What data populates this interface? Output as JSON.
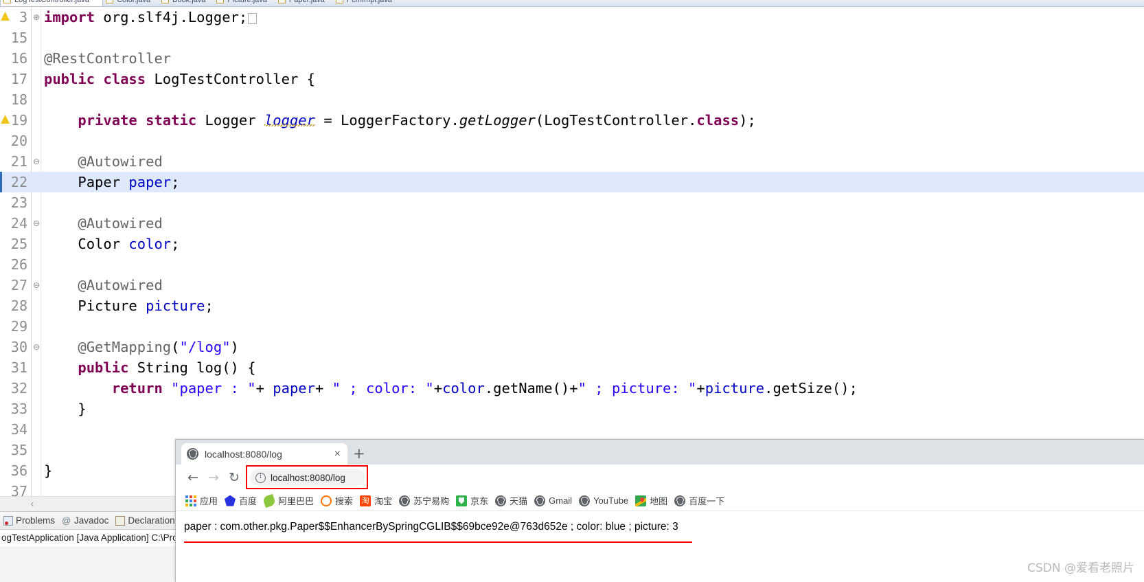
{
  "ide": {
    "editor_tabs": [
      {
        "label": "LogTestController.java",
        "active": true,
        "dirty": true
      },
      {
        "label": "Color.java",
        "active": false,
        "warn": false
      },
      {
        "label": "Book.java",
        "active": false,
        "warn": true
      },
      {
        "label": "Picture.java",
        "active": false,
        "warn": false
      },
      {
        "label": "Paper.java",
        "active": false,
        "warn": false
      },
      {
        "label": "PcmImpl.java",
        "active": false,
        "warn": false
      }
    ],
    "code_lines": [
      {
        "no": "3",
        "fold": "⊕",
        "warn": true,
        "indent": 0,
        "tokens": [
          {
            "t": "import",
            "c": "kw"
          },
          {
            "t": " org.slf4j.Logger;",
            "c": "plain"
          },
          {
            "t": "□",
            "c": "boxmark"
          }
        ]
      },
      {
        "no": "15",
        "fold": "",
        "warn": false,
        "tokens": []
      },
      {
        "no": "16",
        "fold": "",
        "warn": false,
        "tokens": [
          {
            "t": "@RestController",
            "c": "ann"
          }
        ]
      },
      {
        "no": "17",
        "fold": "",
        "warn": false,
        "tokens": [
          {
            "t": "public",
            "c": "kw"
          },
          {
            "t": " ",
            "c": "plain"
          },
          {
            "t": "class",
            "c": "kw"
          },
          {
            "t": " LogTestController {",
            "c": "plain"
          }
        ]
      },
      {
        "no": "18",
        "fold": "",
        "warn": false,
        "tokens": []
      },
      {
        "no": "19",
        "fold": "",
        "warn": true,
        "tokens": [
          {
            "t": "    ",
            "c": "plain"
          },
          {
            "t": "private",
            "c": "kw"
          },
          {
            "t": " ",
            "c": "plain"
          },
          {
            "t": "static",
            "c": "kw"
          },
          {
            "t": " Logger ",
            "c": "plain"
          },
          {
            "t": "logger",
            "c": "fldi-squig"
          },
          {
            "t": " = LoggerFactory.",
            "c": "plain"
          },
          {
            "t": "getLogger",
            "c": "mth"
          },
          {
            "t": "(LogTestController.",
            "c": "plain"
          },
          {
            "t": "class",
            "c": "kw"
          },
          {
            "t": ");",
            "c": "plain"
          }
        ]
      },
      {
        "no": "20",
        "fold": "",
        "warn": false,
        "tokens": []
      },
      {
        "no": "21",
        "fold": "⊖",
        "warn": false,
        "tokens": [
          {
            "t": "    ",
            "c": "plain"
          },
          {
            "t": "@Autowired",
            "c": "ann"
          }
        ]
      },
      {
        "no": "22",
        "fold": "",
        "warn": false,
        "highlight": true,
        "tokens": [
          {
            "t": "    Paper ",
            "c": "plain"
          },
          {
            "t": "paper",
            "c": "fld"
          },
          {
            "t": ";",
            "c": "plain"
          }
        ]
      },
      {
        "no": "23",
        "fold": "",
        "warn": false,
        "tokens": []
      },
      {
        "no": "24",
        "fold": "⊖",
        "warn": false,
        "tokens": [
          {
            "t": "    ",
            "c": "plain"
          },
          {
            "t": "@Autowired",
            "c": "ann"
          }
        ]
      },
      {
        "no": "25",
        "fold": "",
        "warn": false,
        "tokens": [
          {
            "t": "    Color ",
            "c": "plain"
          },
          {
            "t": "color",
            "c": "fld"
          },
          {
            "t": ";",
            "c": "plain"
          }
        ]
      },
      {
        "no": "26",
        "fold": "",
        "warn": false,
        "tokens": []
      },
      {
        "no": "27",
        "fold": "⊖",
        "warn": false,
        "tokens": [
          {
            "t": "    ",
            "c": "plain"
          },
          {
            "t": "@Autowired",
            "c": "ann"
          }
        ]
      },
      {
        "no": "28",
        "fold": "",
        "warn": false,
        "tokens": [
          {
            "t": "    Picture ",
            "c": "plain"
          },
          {
            "t": "picture",
            "c": "fld"
          },
          {
            "t": ";",
            "c": "plain"
          }
        ]
      },
      {
        "no": "29",
        "fold": "",
        "warn": false,
        "tokens": []
      },
      {
        "no": "30",
        "fold": "⊖",
        "warn": false,
        "tokens": [
          {
            "t": "    ",
            "c": "plain"
          },
          {
            "t": "@GetMapping",
            "c": "ann"
          },
          {
            "t": "(",
            "c": "plain"
          },
          {
            "t": "\"/log\"",
            "c": "str"
          },
          {
            "t": ")",
            "c": "plain"
          }
        ]
      },
      {
        "no": "31",
        "fold": "",
        "warn": false,
        "tokens": [
          {
            "t": "    ",
            "c": "plain"
          },
          {
            "t": "public",
            "c": "kw"
          },
          {
            "t": " String log() {",
            "c": "plain"
          }
        ]
      },
      {
        "no": "32",
        "fold": "",
        "warn": false,
        "tokens": [
          {
            "t": "        ",
            "c": "plain"
          },
          {
            "t": "return",
            "c": "kw"
          },
          {
            "t": " ",
            "c": "plain"
          },
          {
            "t": "\"paper : \"",
            "c": "str"
          },
          {
            "t": "+ ",
            "c": "plain"
          },
          {
            "t": "paper",
            "c": "fld"
          },
          {
            "t": "+ ",
            "c": "plain"
          },
          {
            "t": "\" ; color: \"",
            "c": "str"
          },
          {
            "t": "+",
            "c": "plain"
          },
          {
            "t": "color",
            "c": "fld"
          },
          {
            "t": ".getName()+",
            "c": "plain"
          },
          {
            "t": "\" ; picture: \"",
            "c": "str"
          },
          {
            "t": "+",
            "c": "plain"
          },
          {
            "t": "picture",
            "c": "fld"
          },
          {
            "t": ".getSize();",
            "c": "plain"
          }
        ]
      },
      {
        "no": "33",
        "fold": "",
        "warn": false,
        "tokens": [
          {
            "t": "    }",
            "c": "plain"
          }
        ]
      },
      {
        "no": "34",
        "fold": "",
        "warn": false,
        "tokens": []
      },
      {
        "no": "35",
        "fold": "",
        "warn": false,
        "tokens": []
      },
      {
        "no": "36",
        "fold": "",
        "warn": false,
        "tokens": [
          {
            "t": "}",
            "c": "plain"
          }
        ]
      },
      {
        "no": "37",
        "fold": "",
        "warn": false,
        "tokens": []
      }
    ],
    "hscroll_arrow": "‹",
    "view_tabs": [
      {
        "label": "Problems",
        "icon": "problems-icon"
      },
      {
        "label": "Javadoc",
        "icon": "at-icon"
      },
      {
        "label": "Declaration",
        "icon": "declaration-icon"
      },
      {
        "label": "",
        "icon": "pencil-icon"
      }
    ],
    "console_line": "ogTestApplication [Java Application] C:\\Progra"
  },
  "browser": {
    "tab": {
      "title": "localhost:8080/log",
      "favicon": "globe-icon",
      "close_label": "×"
    },
    "new_tab_label": "+",
    "nav": {
      "back": "←",
      "forward": "→",
      "reload": "↻"
    },
    "omnibox": {
      "url": "localhost:8080/log",
      "info_icon": "info-circle-icon",
      "highlight_color": "#ff0000"
    },
    "bookmarks": [
      {
        "label": "应用",
        "icon": "apps-grid-icon"
      },
      {
        "label": "百度",
        "icon": "baidu-icon"
      },
      {
        "label": "阿里巴巴",
        "icon": "alibaba-icon"
      },
      {
        "label": "搜索",
        "icon": "sogou-icon"
      },
      {
        "label": "淘宝",
        "icon": "taobao-icon"
      },
      {
        "label": "苏宁易购",
        "icon": "globe-icon"
      },
      {
        "label": "京东",
        "icon": "jd-icon"
      },
      {
        "label": "天猫",
        "icon": "globe-icon"
      },
      {
        "label": "Gmail",
        "icon": "globe-icon"
      },
      {
        "label": "YouTube",
        "icon": "globe-icon"
      },
      {
        "label": "地图",
        "icon": "google-maps-icon"
      },
      {
        "label": "百度一下",
        "icon": "globe-icon"
      }
    ],
    "page": {
      "response_text": "paper : com.other.pkg.Paper$$EnhancerBySpringCGLIB$$69bce92e@763d652e ; color: blue ; picture: 3",
      "underline_color": "#ff0000"
    }
  },
  "watermark": "CSDN @爱看老照片"
}
